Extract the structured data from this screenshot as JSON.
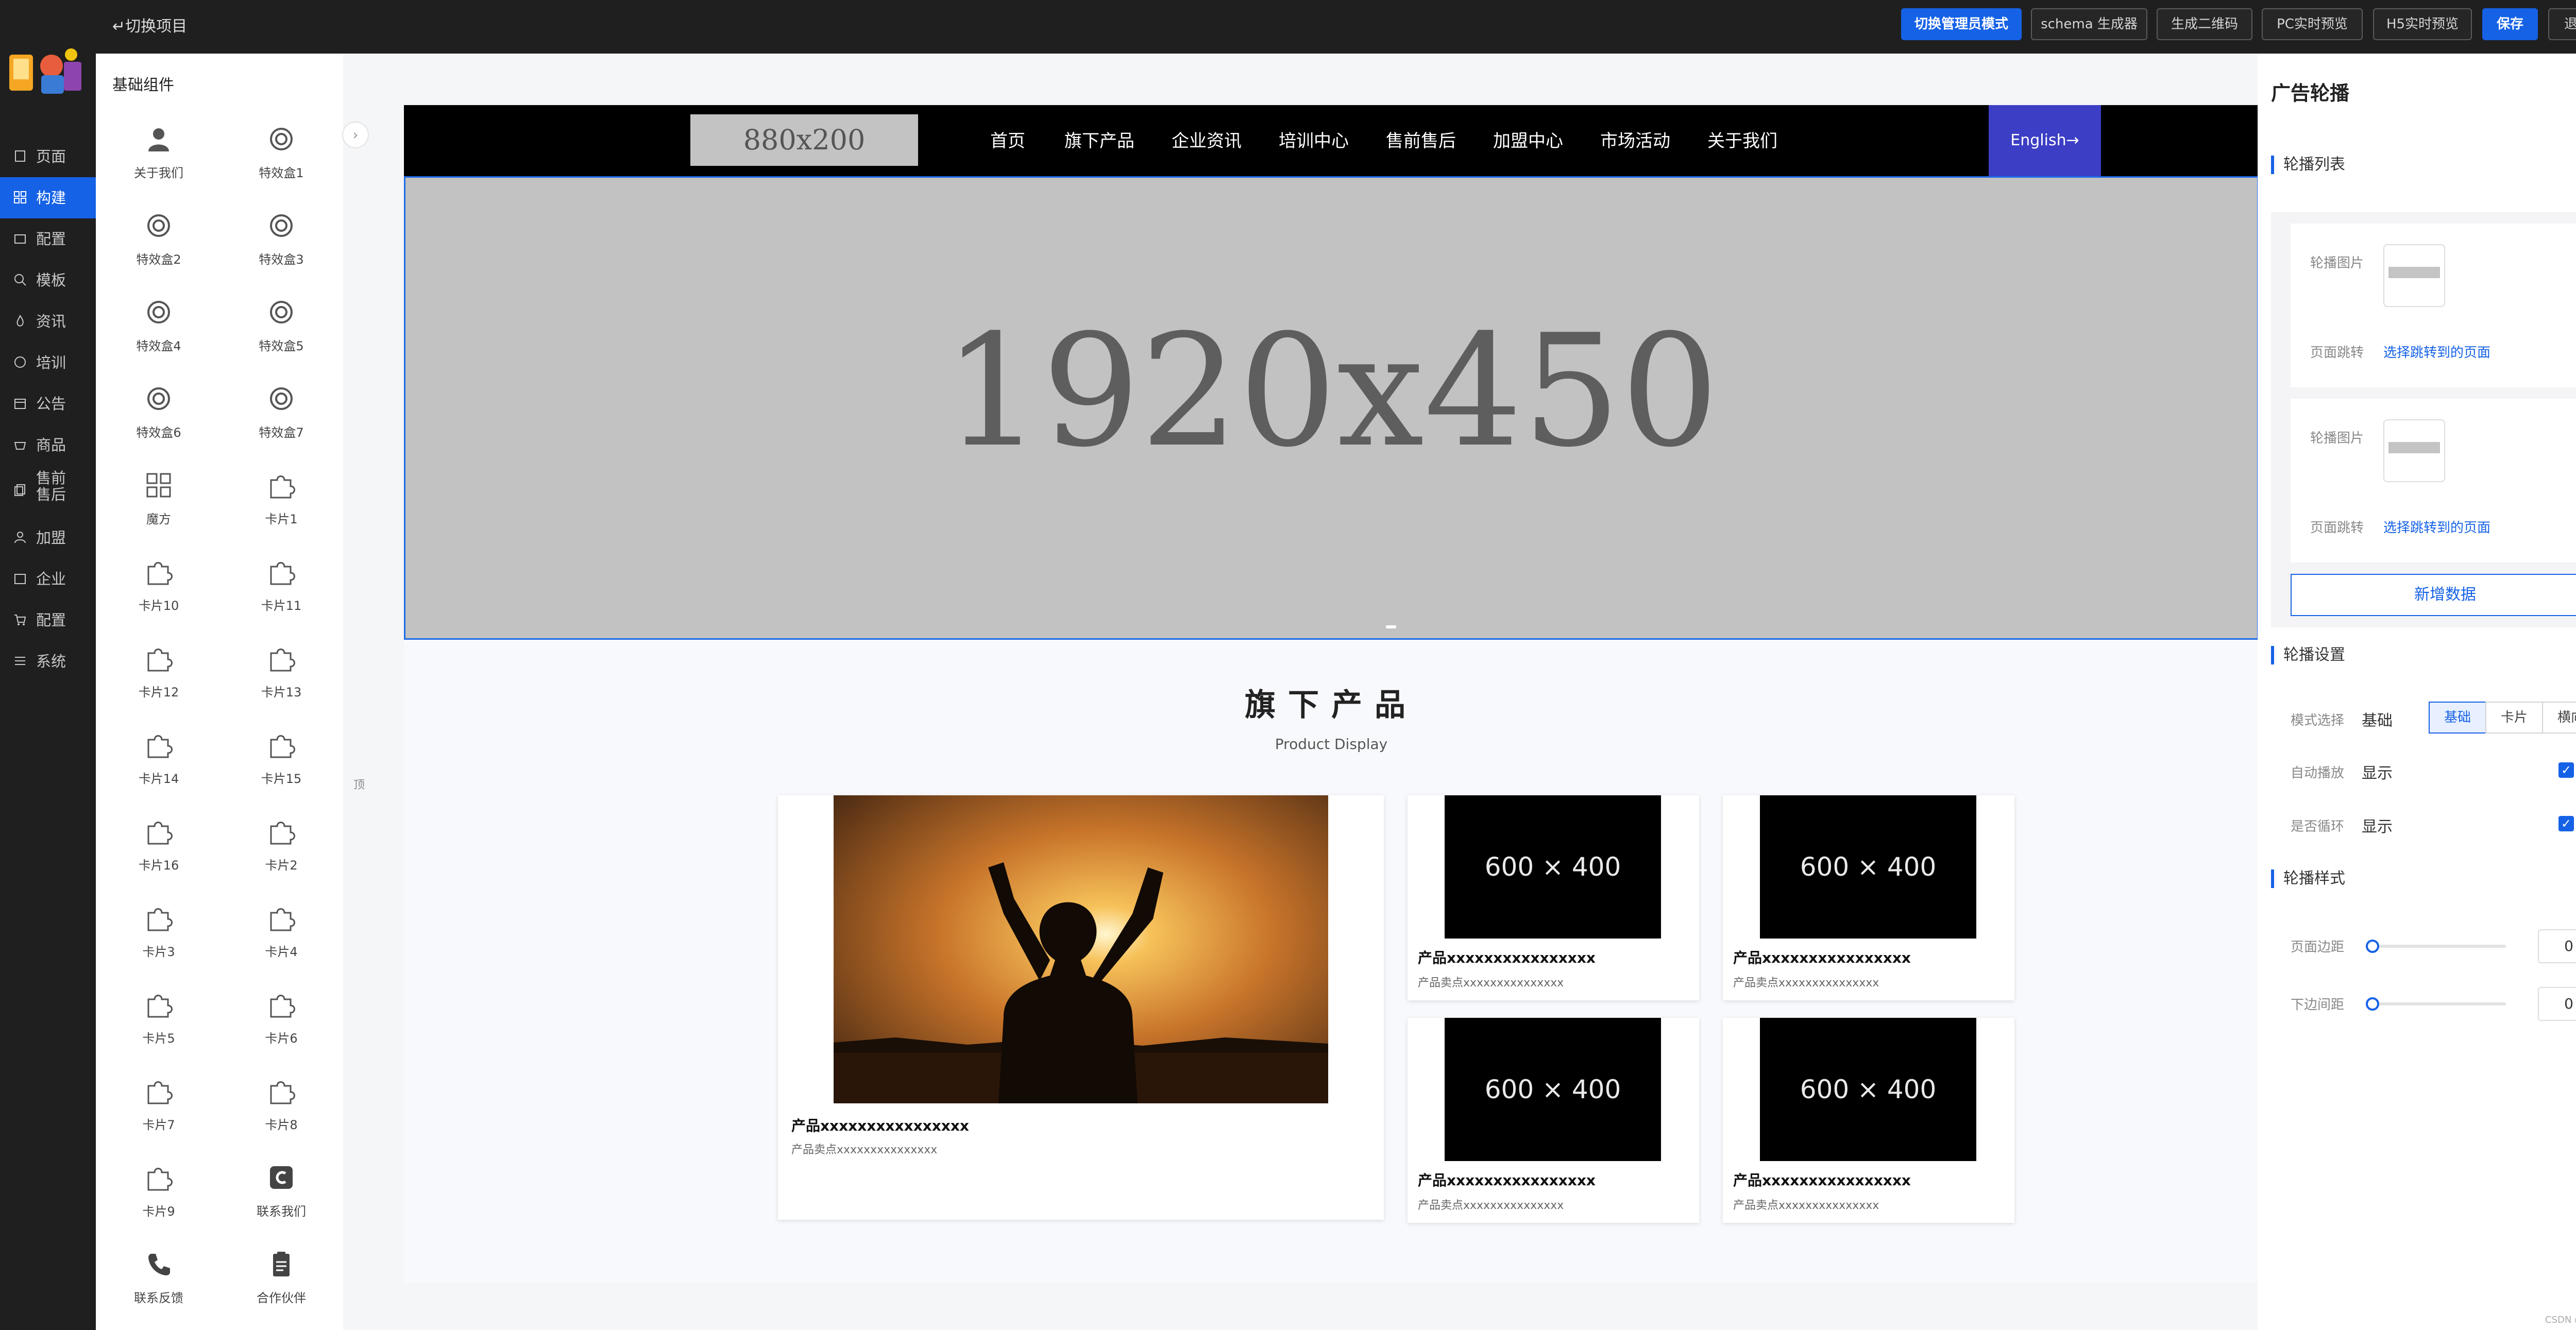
{
  "topbar": {
    "switch_project": "↵切换项目",
    "buttons": [
      "切换管理员模式",
      "schema 生成器",
      "生成二维码",
      "PC实时预览",
      "H5实时预览",
      "保存",
      "退出"
    ]
  },
  "leftnav": {
    "items": [
      "页面",
      "构建",
      "配置",
      "模板",
      "资讯",
      "培训",
      "公告",
      "商品",
      "售前售后",
      "加盟",
      "企业",
      "配置",
      "系统"
    ]
  },
  "components": {
    "title": "基础组件",
    "items": [
      "关于我们",
      "特效盒1",
      "特效盒2",
      "特效盒3",
      "特效盒4",
      "特效盒5",
      "特效盒6",
      "特效盒7",
      "魔方",
      "卡片1",
      "卡片10",
      "卡片11",
      "卡片12",
      "卡片13",
      "卡片14",
      "卡片15",
      "卡片16",
      "卡片2",
      "卡片3",
      "卡片4",
      "卡片5",
      "卡片6",
      "卡片7",
      "卡片8",
      "卡片9",
      "联系我们",
      "联系反馈",
      "合作伙伴"
    ]
  },
  "canvas": {
    "ruler_mark": "顶",
    "site_logo": "880x200",
    "nav": [
      "首页",
      "旗下产品",
      "企业资讯",
      "培训中心",
      "售前售后",
      "加盟中心",
      "市场活动",
      "关于我们"
    ],
    "english": "English→",
    "banner": "1920x450",
    "section_title": "旗下产品",
    "section_subtitle": "Product Display",
    "placeholder_text": "600 × 400",
    "products": [
      {
        "name": "产品xxxxxxxxxxxxxxxx",
        "desc": "产品卖点xxxxxxxxxxxxxxx"
      },
      {
        "name": "产品xxxxxxxxxxxxxxxx",
        "desc": "产品卖点xxxxxxxxxxxxxxx"
      },
      {
        "name": "产品xxxxxxxxxxxxxxxx",
        "desc": "产品卖点xxxxxxxxxxxxxxx"
      },
      {
        "name": "产品xxxxxxxxxxxxxxxx",
        "desc": "产品卖点xxxxxxxxxxxxxxx"
      },
      {
        "name": "产品xxxxxxxxxxxxxxxx",
        "desc": "产品卖点xxxxxxxxxxxxxxx"
      }
    ]
  },
  "right_panel": {
    "title": "广告轮播",
    "list_section": "轮播列表",
    "image_label": "轮播图片",
    "jump_label": "页面跳转",
    "jump_link": "选择跳转到的页面",
    "add_button": "新增数据",
    "settings_section": "轮播设置",
    "mode_label": "模式选择",
    "mode_value": "基础",
    "mode_options": [
      "基础",
      "卡片",
      "横向"
    ],
    "autoplay_label": "自动播放",
    "autoplay_value": "显示",
    "loop_label": "是否循环",
    "loop_value": "显示",
    "style_section": "轮播样式",
    "margin_label": "页面边距",
    "margin_value": "0",
    "spacing_label": "下边间距",
    "spacing_value": "0"
  },
  "watermark": "CSDN @会发光的"
}
